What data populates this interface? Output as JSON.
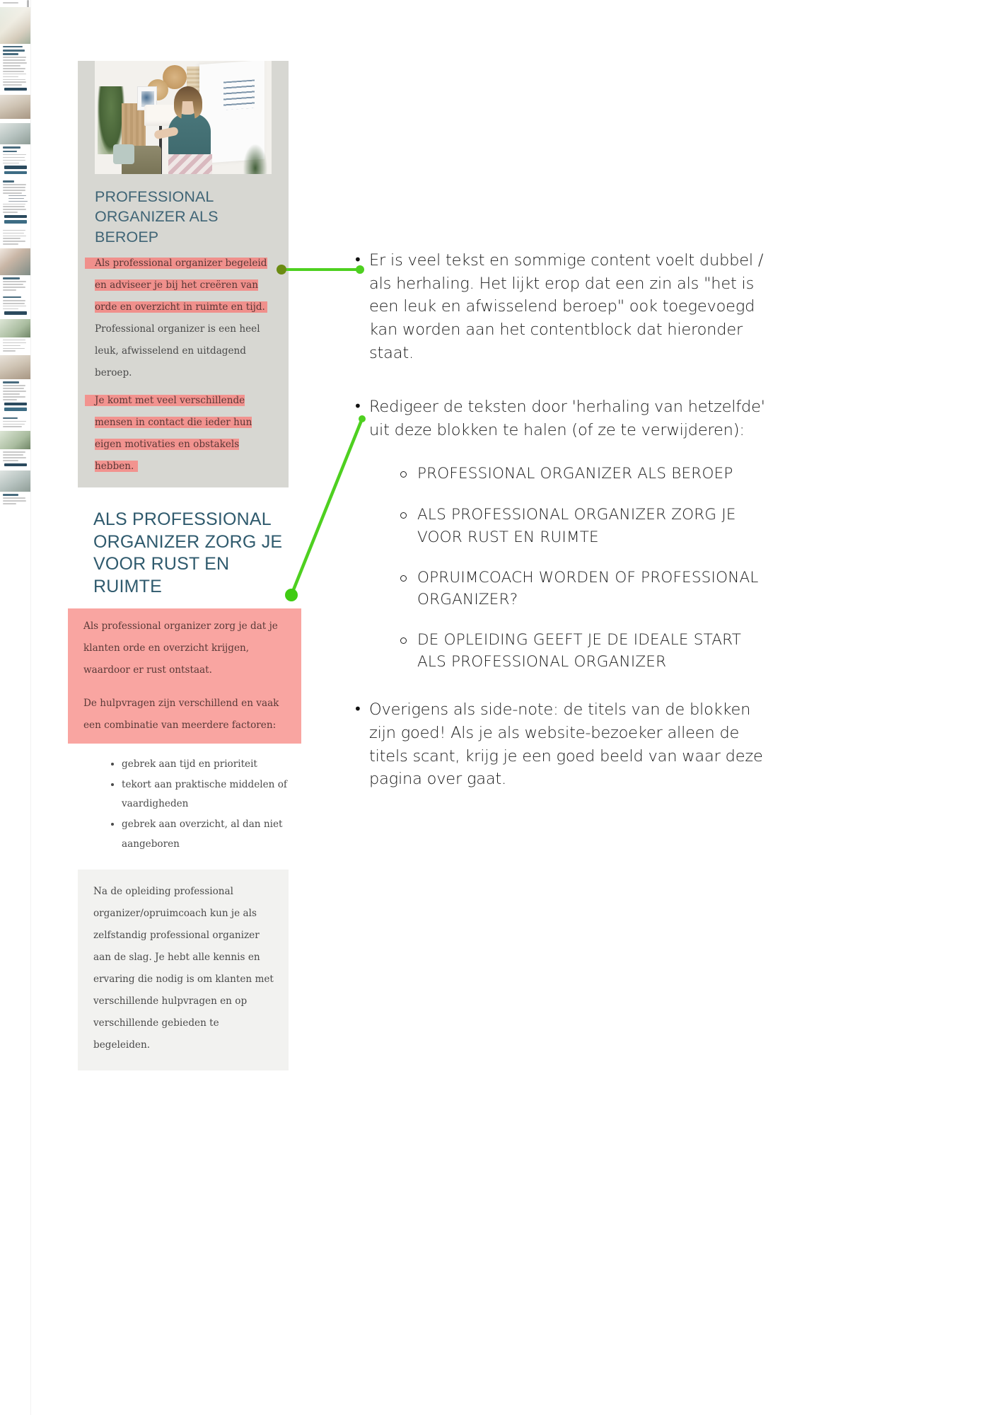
{
  "screenshot": {
    "card": {
      "heading_1": "PROFESSIONAL ORGANIZER ALS BEROEP",
      "paragraph_1_highlight": "Als professional organizer begeleid en adviseer je bij het creëren van orde en overzicht in ruimte en tijd.",
      "paragraph_1_rest": " Professional organizer is een heel leuk, afwisselend en uitdagend beroep.",
      "paragraph_2_highlight": "Je komt met veel verschillende mensen in contact die ieder hun eigen motivaties en obstakels hebben."
    },
    "section_2": {
      "heading_2": "ALS PROFESSIONAL ORGANIZER ZORG JE VOOR RUST EN RUIMTE",
      "pink_paragraph_1": "Als professional organizer zorg je dat je klanten orde en overzicht krijgen, waardoor er rust ontstaat.",
      "pink_paragraph_2": "De hulpvragen zijn verschillend en vaak een combinatie van meerdere factoren:",
      "bullets": [
        "gebrek aan tijd en prioriteit",
        "tekort aan praktische middelen of vaardigheden",
        "gebrek aan overzicht, al dan niet aangeboren"
      ],
      "closing_paragraph": "Na de opleiding professional organizer/opruimcoach kun je als zelfstandig professional organizer aan de slag. Je hebt alle kennis en ervaring die nodig is om klanten met verschillende hulpvragen en op verschillende gebieden te begeleiden."
    }
  },
  "notes": {
    "items": [
      {
        "text": "Er is veel tekst en sommige content voelt dubbel / als herhaling. Het lijkt erop dat een zin als \"het is een leuk en afwisselend beroep\" ook toegevoegd kan worden aan het contentblock dat hieronder staat."
      },
      {
        "text": "Redigeer de teksten door 'herhaling van hetzelfde' uit deze blokken te halen (of ze te verwijderen):",
        "sub_items": [
          "PROFESSIONAL ORGANIZER ALS BEROEP",
          "ALS PROFESSIONAL ORGANIZER ZORG JE VOOR RUST EN RUIMTE",
          "OPRUIMCOACH WORDEN OF PROFESSIONAL ORGANIZER?",
          "DE OPLEIDING GEEFT JE DE IDEALE START ALS PROFESSIONAL ORGANIZER"
        ]
      },
      {
        "text": "Overigens als side-note: de titels van de blokken zijn goed! Als je als website-bezoeker alleen de titels scant, krijg je een goed beeld van waar deze pagina over gaat."
      }
    ],
    "bullet_glyph": "•"
  },
  "colors": {
    "annotation_green": "#4ed020",
    "highlight_pink": "#f0908c",
    "pink_block": "#f9a5a1",
    "card_gray": "#d7d7d2",
    "heading_teal": "#3f6475"
  }
}
